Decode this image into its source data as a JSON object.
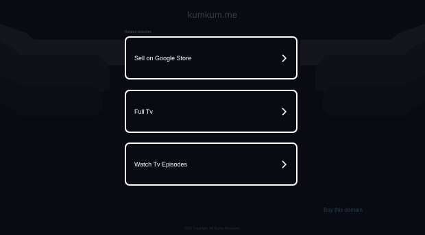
{
  "header": {
    "title": "kumkum.me"
  },
  "related": {
    "label": "Related searches",
    "items": [
      {
        "label": "Sell on Google Store"
      },
      {
        "label": "Full Tv"
      },
      {
        "label": "Watch Tv Episodes"
      }
    ]
  },
  "links": {
    "buy_domain": "Buy this domain"
  },
  "footer": {
    "text": "2025 Copyright. All Rights Reserved."
  },
  "colors": {
    "background": "#0a0b12",
    "card_border": "#ffffff",
    "text": "#ffffff"
  },
  "icons": {
    "card_arrow": "chevron-right-icon"
  }
}
